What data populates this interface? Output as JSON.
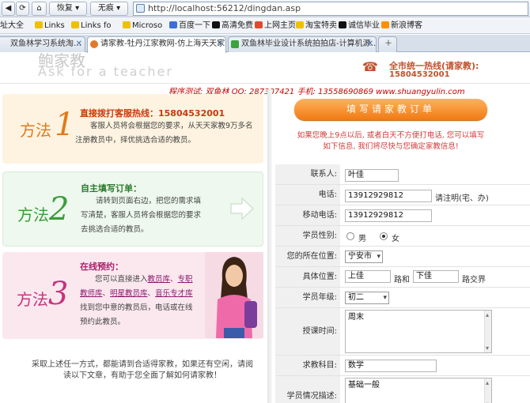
{
  "browser": {
    "back_label": "",
    "refresh_label": "",
    "home_label": "",
    "restore_label": "恢复",
    "nohead_label": "无痕",
    "url": "http://localhost:56212/dingdan.asp"
  },
  "bookmarks": [
    {
      "label": "址大全",
      "color": "#e88a1a"
    },
    {
      "label": "Links",
      "color": "#f0c000"
    },
    {
      "label": "Links fo",
      "color": "#f0c000"
    },
    {
      "label": "Microso",
      "color": "#f0c000"
    },
    {
      "label": "百度一下",
      "color": "#3b6fd8"
    },
    {
      "label": "高清免费",
      "color": "#111111"
    },
    {
      "label": "上网主页",
      "color": "#e04a2a"
    },
    {
      "label": "淘宝特卖",
      "color": "#f0c000"
    },
    {
      "label": "诚信毕业",
      "color": "#111111"
    },
    {
      "label": "新浪博客",
      "color": "#ff9000"
    }
  ],
  "tabs": [
    {
      "label": "双鱼林学习系统淘…"
    },
    {
      "label": "请家教-牡丹江家教网-仿上海天天家…"
    },
    {
      "label": "双鱼林毕业设计系统拍拍店-计算机源…"
    }
  ],
  "header": {
    "logo_text": "鲍家教",
    "slogan": "Ask for a teacher",
    "hotline_title": "全市统一热线(请家教):",
    "hotline_number": "15804532001"
  },
  "credit": "程序测试: 双鱼林  QQ: 287307421  手机: 13558690869  www.shuangyulin.com",
  "methods": [
    {
      "word": "方法",
      "num": "1",
      "title": "直接拨打客服热线：15804532001",
      "body": "客服人员将会根据您的要求，从天天家教9万多名注册教员中，择优挑选合适的教员。"
    },
    {
      "word": "方法",
      "num": "2",
      "title": "自主填写订单：",
      "body": "请转到页面右边，把您的需求填写清楚，客服人员将会根据您的要求去挑选合适的教员。"
    },
    {
      "word": "方法",
      "num": "3",
      "title": "在线预约：",
      "body_pre": "您可以直接进入",
      "links": [
        "教员库",
        "专职教师库",
        "明星教员库",
        "音乐专才库"
      ],
      "body_post": "找到您中意的教员后，电话或在线预约此教员。"
    }
  ],
  "bottom_text": "采取上述任一方式，都能请到合适得家教，如果还有空闲，请阅读以下文章，有助于您全面了解如何请家教！",
  "order": {
    "title": "填写请家教订单",
    "notice": "如果您晚上9点以后, 或者白天不方便打电话, 您可以填写如下信息, 我们将尽快与您确定家教信息!",
    "fields": {
      "contact_label": "联系人:",
      "contact_value": "叶佳",
      "phone_label": "电话:",
      "phone_value": "13912929812",
      "phone_note": "请注明(宅、办)",
      "mobile_label": "移动电话:",
      "mobile_value": "13912929812",
      "gender_label": "学员性别:",
      "gender_male": "男",
      "gender_female": "女",
      "gender_selected": "女",
      "city_label": "您的所在位置:",
      "city_value": "宁安市",
      "location_label": "具体位置:",
      "road1_value": "上佳",
      "road_and": "路和",
      "road2_value": "下佳",
      "road_cross": "路交界",
      "grade_label": "学员年级:",
      "grade_value": "初二",
      "time_label": "授课时间:",
      "time_value": "周末",
      "subject_label": "求教科目:",
      "subject_value": "数学",
      "desc_label": "学员情况描述:",
      "desc_value": "基础一般"
    }
  }
}
